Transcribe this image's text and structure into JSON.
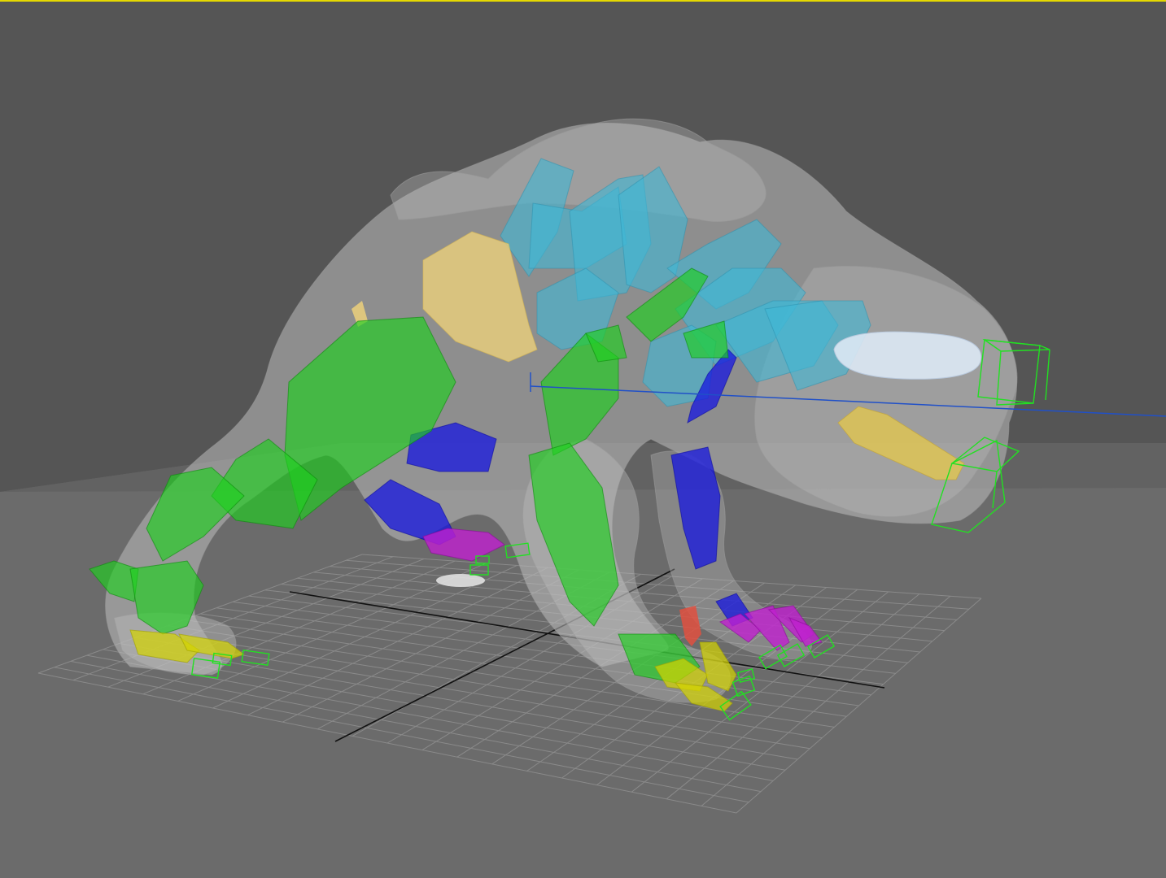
{
  "viewport": {
    "type": "3d-perspective-viewport",
    "active": true,
    "background_color": "#555555",
    "floor_color": "#6b6b6b",
    "active_border_color": "#e5d800",
    "home_grid": {
      "visible": true,
      "line_color": "#8a8a8a",
      "axis_color": "#111111"
    }
  },
  "scene": {
    "subject": "quadruped-creature-rig",
    "mesh": {
      "display": "see-through",
      "color": "#bdbdbd"
    },
    "bone_colors": {
      "spine": "#3fb8d6",
      "limbs_primary": "#1fcf1f",
      "limbs_secondary": "#1616e0",
      "fingers": "#c020d0",
      "clavicle": "#f2d47a",
      "jaw": "#e6c84a",
      "head": "#dce8f4",
      "toes": "#d4d400",
      "helpers": "#22e022",
      "axis_line": "#2050c8"
    },
    "helper_icon": "wireframe-box-icon"
  }
}
